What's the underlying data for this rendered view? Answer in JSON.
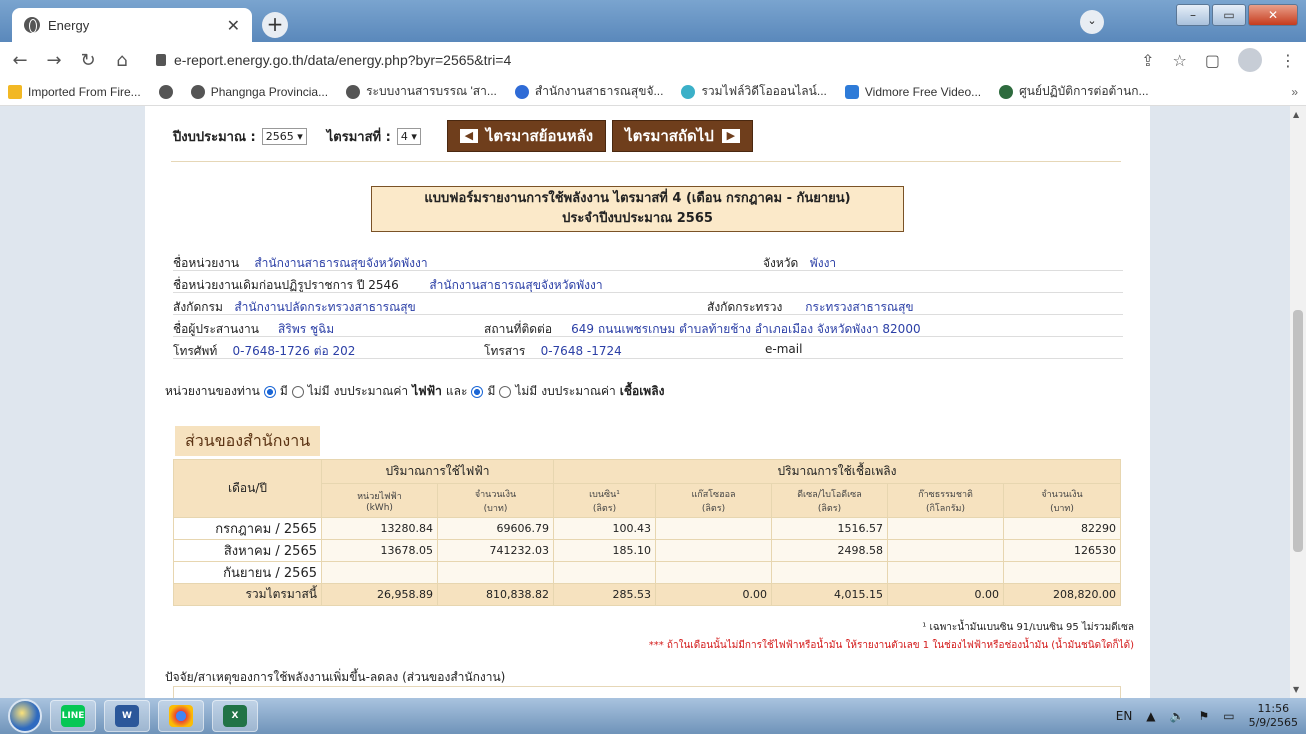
{
  "browser": {
    "tab_title": "Energy",
    "url": "e-report.energy.go.th/data/energy.php?byr=2565&tri=4",
    "bookmarks": [
      "Imported From Fire...",
      "Phangnga Provincia...",
      "ระบบงานสารบรรณ 'สา...",
      "สำนักงานสาธารณสุขจั...",
      "รวมไฟล์วิดีโอออนไลน์...",
      "Vidmore Free Video...",
      "ศูนย์ปฏิบัติการต่อต้านก..."
    ]
  },
  "selectors": {
    "year_label": "ปีงบประมาณ :",
    "year_value": "2565",
    "quarter_label": "ไตรมาสที่ :",
    "quarter_value": "4",
    "prev_label": "ไตรมาสย้อนหลัง",
    "next_label": "ไตรมาสถัดไป"
  },
  "form_title": {
    "line1": "แบบฟอร์มรายงานการใช้พลังงาน ไตรมาสที่ 4 (เดือน กรกฎาคม - กันยายน)",
    "line2": "ประจำปีงบประมาณ 2565"
  },
  "info": {
    "agency_label": "ชื่อหน่วยงาน",
    "agency_value": "สำนักงานสาธารณสุขจังหวัดพังงา",
    "province_label": "จังหวัด",
    "province_value": "พังงา",
    "former_label": "ชื่อหน่วยงานเดิมก่อนปฏิรูปราชการ ปี 2546",
    "former_value": "สำนักงานสาธารณสุขจังหวัดพังงา",
    "dept_label": "สังกัดกรม",
    "dept_value": "สำนักงานปลัดกระทรวงสาธารณสุข",
    "ministry_label": "สังกัดกระทรวง",
    "ministry_value": "กระทรวงสาธารณสุข",
    "coord_label": "ชื่อผู้ประสานงาน",
    "coord_value": "สิริพร ชูฉิม",
    "address_label": "สถานที่ติดต่อ",
    "address_value": "649 ถนนเพชรเกษม ตำบลท้ายช้าง อำเภอเมือง จังหวัดพังงา 82000",
    "phone_label": "โทรศัพท์",
    "phone_value": "0-7648-1726 ต่อ 202",
    "fax_label": "โทรสาร",
    "fax_value": "0-7648 -1724",
    "email_label": "e-mail",
    "email_value": ""
  },
  "budget_row": {
    "prefix": "หน่วยงานของท่าน",
    "yes": "มี",
    "no": "ไม่มี",
    "elec_text": "งบประมาณค่า",
    "elec_bold": "ไฟฟ้า",
    "and": "และ",
    "fuel_text": "งบประมาณค่า",
    "fuel_bold": "เชื้อเพลิง"
  },
  "section_title": "ส่วนของสำนักงาน",
  "table": {
    "month_header": "เดือน/ปี",
    "elec_header": "ปริมาณการใช้ไฟฟ้า",
    "fuel_header": "ปริมาณการใช้เชื้อเพลิง",
    "sub_headers": [
      [
        "หน่วยไฟฟ้า",
        "(kWh)"
      ],
      [
        "จำนวนเงิน",
        "(บาท)"
      ],
      [
        "เบนซิน¹",
        "(ลิตร)"
      ],
      [
        "แก๊สโซฮอล",
        "(ลิตร)"
      ],
      [
        "ดีเซล/ไบโอดีเซล",
        "(ลิตร)"
      ],
      [
        "ก๊าซธรรมชาติ",
        "(กิโลกรัม)"
      ],
      [
        "จำนวนเงิน",
        "(บาท)"
      ]
    ],
    "rows": [
      [
        "กรกฎาคม / 2565",
        "13280.84",
        "69606.79",
        "100.43",
        "",
        "1516.57",
        "",
        "82290"
      ],
      [
        "สิงหาคม / 2565",
        "13678.05",
        "741232.03",
        "185.10",
        "",
        "2498.58",
        "",
        "126530"
      ],
      [
        "กันยายน / 2565",
        "",
        "",
        "",
        "",
        "",
        "",
        ""
      ],
      [
        "รวมไตรมาสนี้",
        "26,958.89",
        "810,838.82",
        "285.53",
        "0.00",
        "4,015.15",
        "0.00",
        "208,820.00"
      ]
    ]
  },
  "notes": {
    "note1": "¹ เฉพาะน้ำมันเบนซิน 91/เบนซิน 95 ไม่รวมดีเซล",
    "note2": "*** ถ้าในเดือนนั้นไม่มีการใช้ไฟฟ้าหรือน้ำมัน ให้รายงานตัวเลข 1 ในช่องไฟฟ้าหรือช่องน้ำมัน (น้ำมันชนิดใดก็ได้)"
  },
  "factors_label": "ปัจจัย/สาเหตุของการใช้พลังงานเพิ่มขึ้น-ลดลง (ส่วนของสำนักงาน)",
  "taskbar": {
    "lang": "EN",
    "time": "11:56",
    "date": "5/9/2565"
  }
}
